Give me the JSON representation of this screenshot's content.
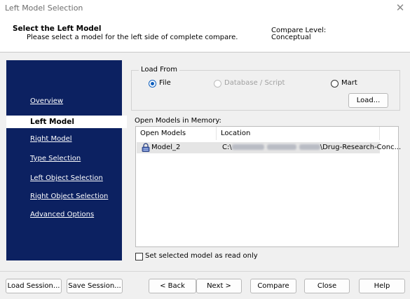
{
  "window": {
    "title": "Left Model Selection",
    "close_glyph": "✕"
  },
  "header": {
    "title": "Select the Left Model",
    "subtitle": "Please select a model for the left side of complete compare.",
    "compare_level_label": "Compare Level:",
    "compare_level_value": "Conceptual"
  },
  "sidebar": {
    "items": [
      {
        "label": "Overview",
        "active": false
      },
      {
        "label": "Left Model",
        "active": true
      },
      {
        "label": "Right Model",
        "active": false
      },
      {
        "label": "Type Selection",
        "active": false
      },
      {
        "label": "Left Object Selection",
        "active": false
      },
      {
        "label": "Right Object Selection",
        "active": false
      },
      {
        "label": "Advanced Options",
        "active": false
      }
    ]
  },
  "load_from": {
    "legend": "Load From",
    "options": [
      {
        "label": "File",
        "selected": true,
        "enabled": true
      },
      {
        "label": "Database / Script",
        "selected": false,
        "enabled": false
      },
      {
        "label": "Mart",
        "selected": false,
        "enabled": true
      }
    ],
    "load_button": "Load..."
  },
  "memory": {
    "label": "Open Models in Memory:",
    "columns": [
      "Open Models",
      "Location"
    ],
    "rows": [
      {
        "model": "Model_2",
        "location_prefix": "C:\\",
        "location_suffix": "\\Drug-Research-Conc...",
        "icon": "lock-model-icon",
        "selected": true
      }
    ]
  },
  "read_only": {
    "label": "Set selected model as read only",
    "checked": false
  },
  "footer": {
    "load_session": "Load Session...",
    "save_session": "Save Session...",
    "back": "< Back",
    "next": "Next >",
    "compare": "Compare",
    "close": "Close",
    "help": "Help"
  },
  "colors": {
    "sidebar_bg": "#0c2161",
    "radio_accent": "#0d5ebd",
    "row_highlight": "#e5e5e5"
  }
}
